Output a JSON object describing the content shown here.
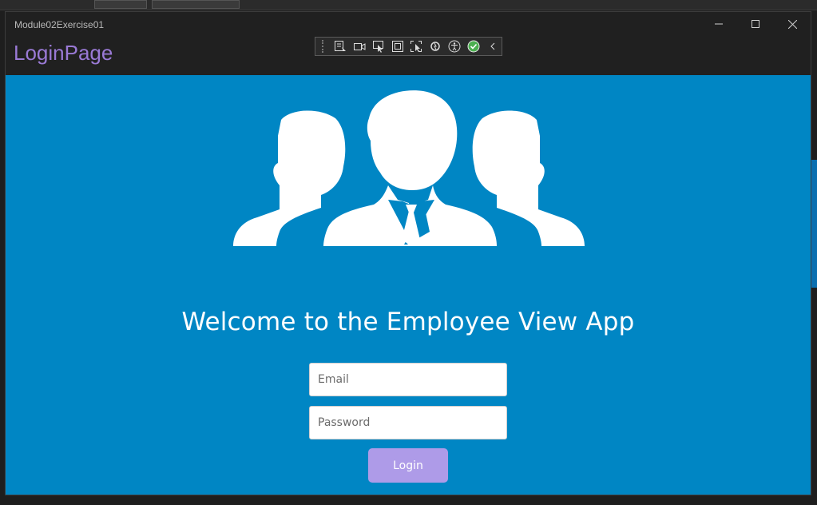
{
  "window": {
    "title": "Module02Exercise01"
  },
  "page": {
    "title": "LoginPage"
  },
  "devbar": {
    "icons": [
      "select-element-icon",
      "video-icon",
      "pointer-icon",
      "frame-icon",
      "layout-adorner-icon",
      "hot-reload-icon",
      "accessibility-icon",
      "check-icon",
      "collapse-icon"
    ]
  },
  "main": {
    "welcome_text": "Welcome to the Employee View App",
    "email_placeholder": "Email",
    "password_placeholder": "Password",
    "login_label": "Login"
  },
  "colors": {
    "content_background": "#0086c4",
    "title_accent": "#9a7ad6",
    "login_button": "#ae9be8"
  }
}
